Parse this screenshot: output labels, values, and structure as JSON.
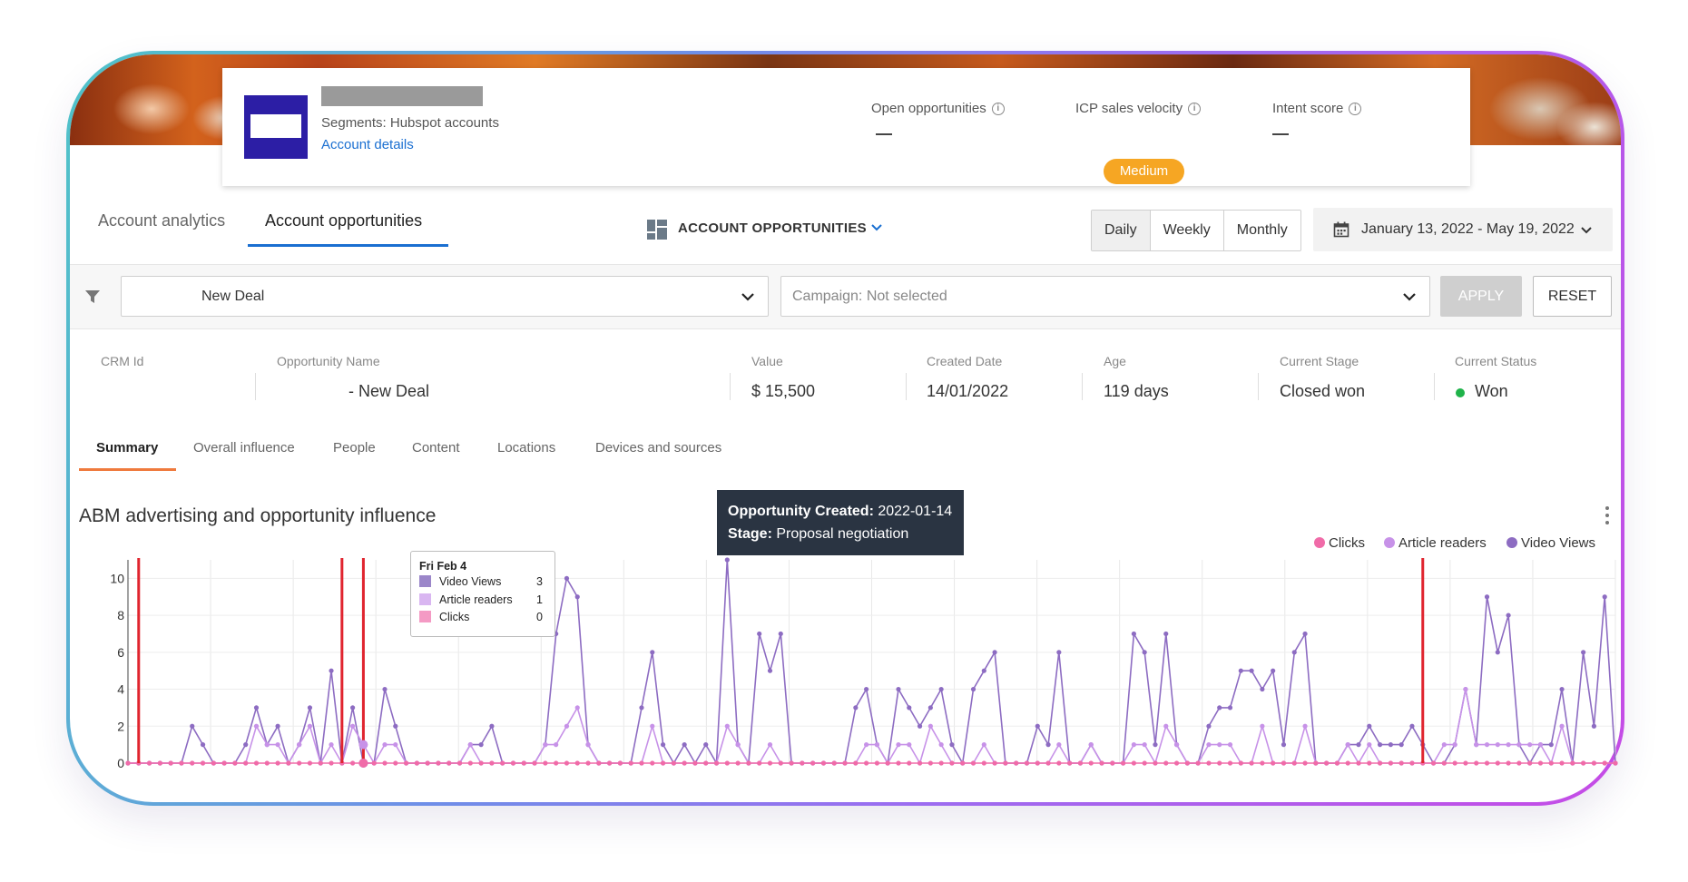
{
  "header": {
    "segments": "Segments: Hubspot accounts",
    "account_details": "Account details",
    "open_opportunities_label": "Open opportunities",
    "icp_label": "ICP sales velocity",
    "icp_value": "Medium",
    "intent_label": "Intent score",
    "info_glyph": "i"
  },
  "tabs": {
    "analytics": "Account analytics",
    "opportunities": "Account opportunities"
  },
  "dashboard_select": "ACCOUNT OPPORTUNITIES",
  "periods": [
    "Daily",
    "Weekly",
    "Monthly"
  ],
  "active_period": "Daily",
  "date_range": "January 13, 2022 - May 19, 2022",
  "filters": {
    "deal_select": "New Deal",
    "campaign_select": "Campaign: Not selected",
    "apply": "APPLY",
    "reset": "RESET"
  },
  "opportunity": {
    "labels": {
      "crm_id": "CRM Id",
      "name": "Opportunity Name",
      "value": "Value",
      "created": "Created Date",
      "age": "Age",
      "stage": "Current Stage",
      "status": "Current Status"
    },
    "values": {
      "name": "- New Deal",
      "value": "$ 15,500",
      "created": "14/01/2022",
      "age": "119 days",
      "stage": "Closed won",
      "status": "Won"
    }
  },
  "subtabs": [
    "Summary",
    "Overall influence",
    "People",
    "Content",
    "Locations",
    "Devices and sources"
  ],
  "colors": {
    "clicks": "#f06ba8",
    "article_readers": "#c792e8",
    "video_views": "#8d6cc2",
    "event_marker": "#e0242e",
    "accent_blue": "#1a6fd1",
    "tab_orange": "#ef7a3d"
  },
  "event_tooltip": {
    "created_label": "Opportunity Created:",
    "created_value": "2022-01-14",
    "stage_label": "Stage:",
    "stage_value": "Proposal negotiation"
  },
  "hover_tooltip": {
    "title": "Fri Feb 4",
    "rows": [
      {
        "label": "Video Views",
        "value": "3"
      },
      {
        "label": "Article readers",
        "value": "1"
      },
      {
        "label": "Clicks",
        "value": "0"
      }
    ]
  },
  "chart_data": {
    "type": "line",
    "title": "ABM advertising and opportunity influence",
    "ylim": [
      0,
      11
    ],
    "yticks": [
      "0",
      "2",
      "4",
      "6",
      "8",
      "10"
    ],
    "grid": true,
    "legend_position": "top-right",
    "series": [
      {
        "name": "Video Views",
        "color": "#8d6cc2",
        "values": [
          0,
          0,
          0,
          0,
          0,
          0,
          2,
          1,
          0,
          0,
          0,
          1,
          3,
          1,
          2,
          0,
          1,
          3,
          0,
          5,
          0,
          3,
          0,
          0,
          4,
          2,
          0,
          0,
          0,
          0,
          0,
          0,
          1,
          1,
          2,
          0,
          0,
          0,
          0,
          1,
          7,
          10,
          9,
          1,
          0,
          0,
          0,
          0,
          3,
          6,
          1,
          0,
          1,
          0,
          1,
          0,
          11,
          1,
          0,
          7,
          5,
          7,
          0,
          0,
          0,
          0,
          0,
          0,
          3,
          4,
          1,
          0,
          4,
          3,
          2,
          3,
          4,
          1,
          0,
          4,
          5,
          6,
          0,
          0,
          0,
          2,
          1,
          6,
          0,
          0,
          1,
          0,
          0,
          0,
          7,
          6,
          1,
          7,
          1,
          0,
          0,
          2,
          3,
          3,
          5,
          5,
          4,
          5,
          1,
          6,
          7,
          0,
          0,
          0,
          1,
          1,
          2,
          1,
          1,
          1,
          2,
          1,
          0,
          0,
          1,
          4,
          1,
          9,
          6,
          8,
          1,
          0,
          1,
          1,
          4,
          0,
          6,
          2,
          9,
          0
        ]
      },
      {
        "name": "Article readers",
        "color": "#c792e8",
        "values": [
          0,
          0,
          0,
          0,
          0,
          0,
          0,
          0,
          0,
          0,
          0,
          0,
          2,
          1,
          1,
          0,
          1,
          2,
          0,
          1,
          0,
          2,
          1,
          0,
          1,
          1,
          0,
          0,
          0,
          0,
          0,
          0,
          1,
          0,
          0,
          0,
          0,
          0,
          0,
          1,
          1,
          2,
          3,
          1,
          0,
          0,
          0,
          0,
          0,
          2,
          0,
          0,
          0,
          0,
          0,
          0,
          2,
          1,
          0,
          0,
          1,
          0,
          0,
          0,
          0,
          0,
          0,
          0,
          0,
          1,
          1,
          0,
          1,
          1,
          0,
          2,
          1,
          0,
          0,
          0,
          1,
          0,
          0,
          0,
          0,
          0,
          0,
          1,
          0,
          0,
          1,
          0,
          0,
          0,
          1,
          1,
          0,
          2,
          1,
          0,
          0,
          1,
          1,
          1,
          0,
          0,
          2,
          0,
          0,
          0,
          2,
          0,
          0,
          0,
          1,
          0,
          1,
          0,
          0,
          0,
          0,
          0,
          0,
          1,
          1,
          4,
          1,
          1,
          1,
          1,
          1,
          1,
          1,
          0,
          2,
          0,
          0,
          0,
          0,
          0
        ]
      },
      {
        "name": "Clicks",
        "color": "#f06ba8",
        "values": [
          0,
          0,
          0,
          0,
          0,
          0,
          0,
          0,
          0,
          0,
          0,
          0,
          0,
          0,
          0,
          0,
          0,
          0,
          0,
          0,
          0,
          0,
          0,
          0,
          0,
          0,
          0,
          0,
          0,
          0,
          0,
          0,
          0,
          0,
          0,
          0,
          0,
          0,
          0,
          0,
          0,
          0,
          0,
          0,
          0,
          0,
          0,
          0,
          0,
          0,
          0,
          0,
          0,
          0,
          0,
          0,
          0,
          0,
          0,
          0,
          0,
          0,
          0,
          0,
          0,
          0,
          0,
          0,
          0,
          0,
          0,
          0,
          0,
          0,
          0,
          0,
          0,
          0,
          0,
          0,
          0,
          0,
          0,
          0,
          0,
          0,
          0,
          0,
          0,
          0,
          0,
          0,
          0,
          0,
          0,
          0,
          0,
          0,
          0,
          0,
          0,
          0,
          0,
          0,
          0,
          0,
          0,
          0,
          0,
          0,
          0,
          0,
          0,
          0,
          0,
          0,
          0,
          0,
          0,
          0,
          0,
          0,
          0,
          0,
          0,
          0,
          0,
          0,
          0,
          0,
          0,
          0,
          0,
          0,
          0,
          0,
          0,
          0,
          0,
          0
        ]
      }
    ],
    "event_markers": [
      1,
      20,
      22,
      121
    ]
  }
}
